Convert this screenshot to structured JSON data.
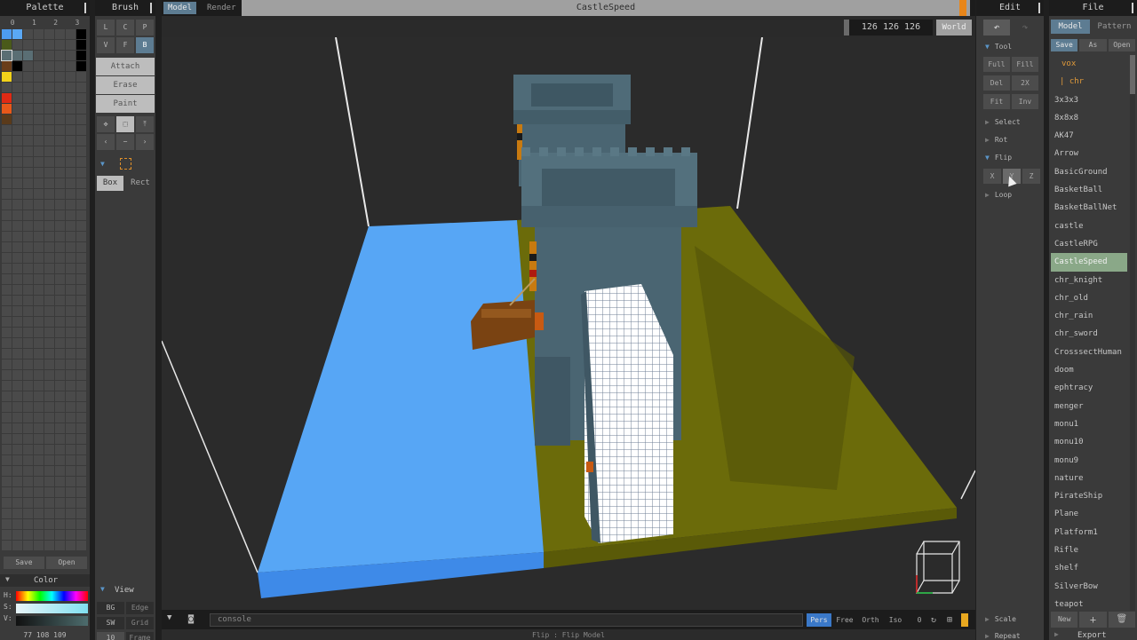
{
  "palette": {
    "title": "Palette",
    "tabs": [
      "0",
      "1",
      "2",
      "3"
    ],
    "save_label": "Save",
    "open_label": "Open",
    "color_section": "Color",
    "hsv_labels": [
      "H:",
      "S:",
      "V:"
    ],
    "rgb_value": "77 108 109",
    "colors": {
      "blue1": "#4d9bf0",
      "blue2": "#5aa8f5",
      "olive": "#4a5a1a",
      "slate": "#5a6e74",
      "brown": "#6a3d1a",
      "yellow": "#f2d21a",
      "red": "#e02a14",
      "orange": "#e8581a",
      "darkbrown": "#5a3a1a"
    }
  },
  "brush": {
    "title": "Brush",
    "mode_row1": [
      "L",
      "C",
      "P"
    ],
    "mode_row2": [
      "V",
      "F",
      "B"
    ],
    "actions": [
      "Attach",
      "Erase",
      "Paint"
    ],
    "box_label": "Box",
    "rect_label": "Rect",
    "view_section": "View",
    "view_row1": [
      "BG",
      "Edge"
    ],
    "view_row2": [
      "SW",
      "Grid"
    ],
    "view_row3": [
      "10",
      "Frame"
    ]
  },
  "viewport": {
    "tab_model": "Model",
    "tab_render": "Render",
    "title": "CastleSpeed",
    "coords": "126 126 126",
    "world_label": "World",
    "console_placeholder": "console",
    "modes": [
      "Pers",
      "Free",
      "Orth",
      "Iso"
    ],
    "zoom_value": "0",
    "status": "Flip : Flip Model"
  },
  "edit": {
    "title": "Edit",
    "tool_section": "Tool",
    "tool_buttons": [
      "Full",
      "Fill",
      "Del",
      "2X",
      "Fit",
      "Inv"
    ],
    "select_section": "Select",
    "rot_section": "Rot",
    "flip_section": "Flip",
    "flip_axes": [
      "X",
      "Y",
      "Z"
    ],
    "loop_section": "Loop",
    "scale_section": "Scale",
    "repeat_section": "Repeat"
  },
  "file": {
    "title": "File",
    "tab_model": "Model",
    "tab_pattern": "Pattern",
    "save_label": "Save",
    "as_label": "As",
    "open_label": "Open",
    "items": [
      "vox",
      "chr",
      "3x3x3",
      "8x8x8",
      "AK47",
      "Arrow",
      "BasicGround",
      "BasketBall",
      "BasketBallNet",
      "castle",
      "CastleRPG",
      "CastleSpeed",
      "chr_knight",
      "chr_old",
      "chr_rain",
      "chr_sword",
      "CrosssectHuman",
      "doom",
      "ephtracy",
      "menger",
      "monu1",
      "monu10",
      "monu9",
      "nature",
      "PirateShip",
      "Plane",
      "Platform1",
      "Rifle",
      "shelf",
      "SilverBow",
      "teapot"
    ],
    "selected": "CastleSpeed",
    "new_label": "New",
    "export_label": "Export"
  }
}
